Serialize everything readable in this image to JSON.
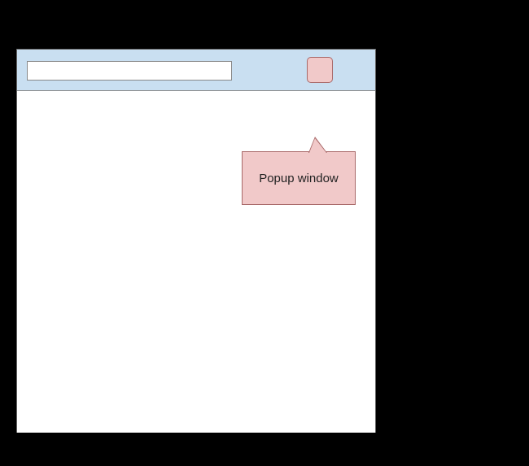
{
  "browser": {
    "toolbar": {
      "url_value": "",
      "extension_button_label": ""
    },
    "popup": {
      "label": "Popup window"
    }
  },
  "colors": {
    "toolbar_bg": "#c9dff1",
    "popup_bg": "#f1c9c9",
    "popup_border": "#a86868",
    "page_bg": "#000000",
    "content_bg": "#ffffff"
  }
}
